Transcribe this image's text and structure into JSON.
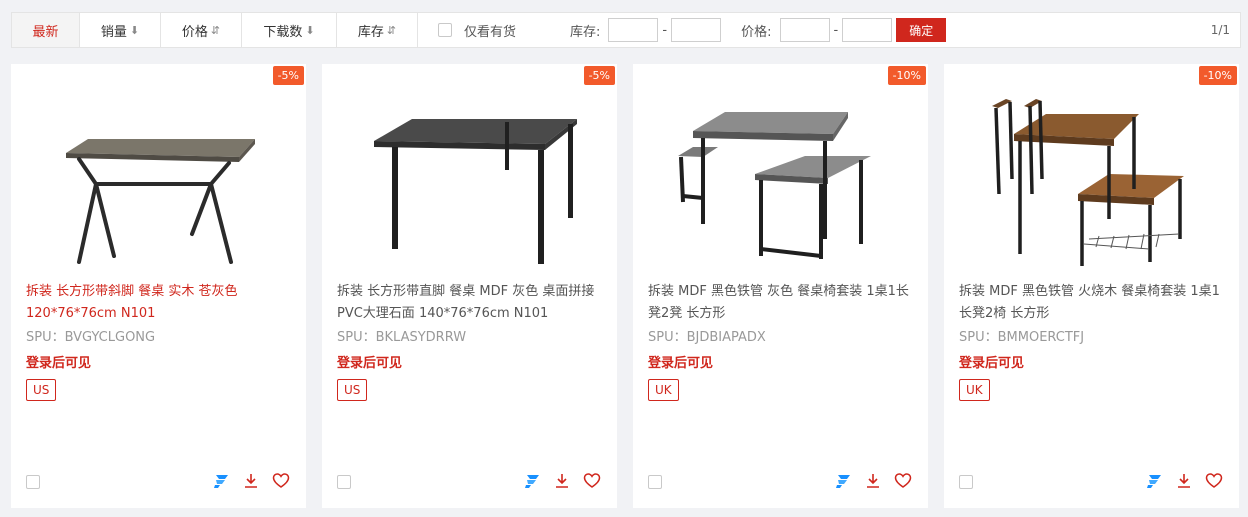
{
  "sort_bar": {
    "newest": "最新",
    "sales": "销量",
    "price": "价格",
    "downloads": "下载数",
    "stock": "库存",
    "in_stock_only": "仅看有货",
    "stock_label": "库存:",
    "price_label": "价格:",
    "range_dash": "-",
    "confirm": "确定",
    "page_count": "1/1"
  },
  "products": [
    {
      "discount": "-5%",
      "title": "拆装 长方形带斜脚 餐桌 实木 苍灰色 120*76*76cm N101",
      "spu": "SPU：BVGYCLGONG",
      "login_note": "登录后可见",
      "region": "US"
    },
    {
      "discount": "-5%",
      "title": "拆装 长方形带直脚 餐桌 MDF 灰色 桌面拼接 PVC大理石面 140*76*76cm N101",
      "spu": "SPU：BKLASYDRRW",
      "login_note": "登录后可见",
      "region": "US"
    },
    {
      "discount": "-10%",
      "title": "拆装 MDF 黑色铁管 灰色 餐桌椅套装 1桌1长凳2凳 长方形",
      "spu": "SPU：BJDBIAPADX",
      "login_note": "登录后可见",
      "region": "UK"
    },
    {
      "discount": "-10%",
      "title": "拆装 MDF 黑色铁管 火烧木 餐桌椅套装 1桌1长凳2椅 长方形",
      "spu": "SPU：BMMOERCTFJ",
      "login_note": "登录后可见",
      "region": "UK"
    }
  ],
  "colors": {
    "accent": "#d0271d",
    "discount": "#f25a2b",
    "brand_icon": "#1890ff"
  },
  "icons": {
    "sort_down": "arrow-down-icon",
    "sort_both": "sort-icon",
    "brand": "brand-f-icon",
    "download": "download-icon",
    "favorite": "heart-icon"
  }
}
